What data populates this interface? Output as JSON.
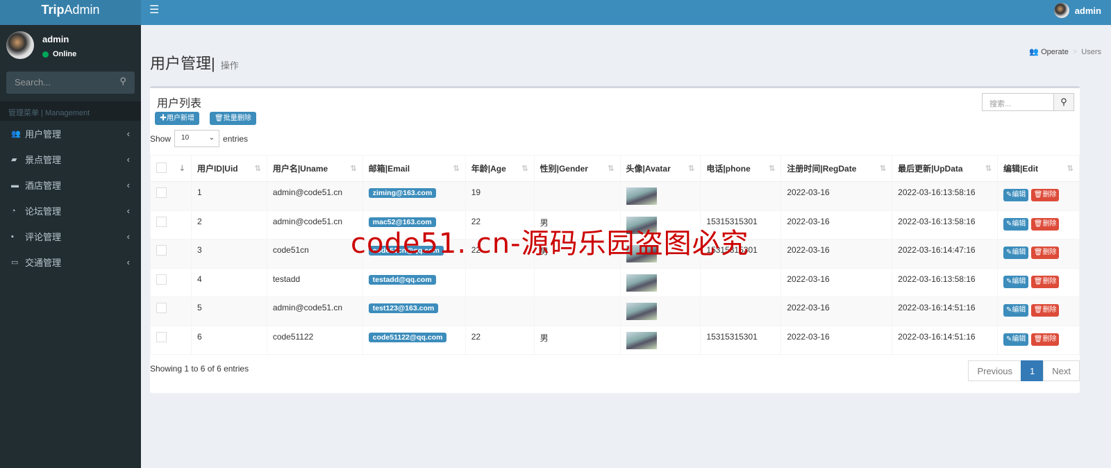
{
  "app": {
    "brand_bold": "Trip",
    "brand_rest": "Admin",
    "top_user": "admin"
  },
  "sidebar": {
    "user": "admin",
    "status": "Online",
    "search_placeholder": "Search...",
    "section": "管理菜单 | Management",
    "items": [
      {
        "label": "用户管理",
        "icon": "users-icon"
      },
      {
        "label": "景点管理",
        "icon": "book-icon"
      },
      {
        "label": "酒店管理",
        "icon": "bed-icon"
      },
      {
        "label": "论坛管理",
        "icon": "rss-icon"
      },
      {
        "label": "评论管理",
        "icon": "comment-icon"
      },
      {
        "label": "交通管理",
        "icon": "car-icon"
      }
    ]
  },
  "page": {
    "title": "用户管理|",
    "subtitle": "操作",
    "breadcrumb": [
      "Operate",
      "Users"
    ]
  },
  "box": {
    "title": "用户列表",
    "add_label": "✚用户新增",
    "batch_delete_label": "🗑批量删除",
    "search_placeholder": "搜索...",
    "show": "Show",
    "entries": "entries",
    "page_size": "10",
    "columns": [
      "用户ID|Uid",
      "用户名|Uname",
      "邮箱|Email",
      "年龄|Age",
      "性别|Gender",
      "头像|Avatar",
      "电话|phone",
      "注册时间|RegDate",
      "最后更新|UpData",
      "编辑|Edit"
    ],
    "rows": [
      {
        "uid": "1",
        "uname": "admin@code51.cn",
        "email": "ziming@163.com",
        "age": "19",
        "gender": "",
        "phone": "",
        "reg": "2022-03-16",
        "upd": "2022-03-16:13:58:16"
      },
      {
        "uid": "2",
        "uname": "admin@code51.cn",
        "email": "mac52@163.com",
        "age": "22",
        "gender": "男",
        "phone": "15315315301",
        "reg": "2022-03-16",
        "upd": "2022-03-16:13:58:16"
      },
      {
        "uid": "3",
        "uname": "code51cn",
        "email": "code51cn@qq.com",
        "age": "22",
        "gender": "男",
        "phone": "15315315301",
        "reg": "2022-03-16",
        "upd": "2022-03-16:14:47:16"
      },
      {
        "uid": "4",
        "uname": "testadd",
        "email": "testadd@qq.com",
        "age": "",
        "gender": "",
        "phone": "",
        "reg": "2022-03-16",
        "upd": "2022-03-16:13:58:16"
      },
      {
        "uid": "5",
        "uname": "admin@code51.cn",
        "email": "test123@163.com",
        "age": "",
        "gender": "",
        "phone": "",
        "reg": "2022-03-16",
        "upd": "2022-03-16:14:51:16"
      },
      {
        "uid": "6",
        "uname": "code51122",
        "email": "code51122@qq.com",
        "age": "22",
        "gender": "男",
        "phone": "15315315301",
        "reg": "2022-03-16",
        "upd": "2022-03-16:14:51:16"
      }
    ],
    "edit_label": "✎编辑",
    "delete_label": "🗑删除",
    "info": "Showing 1 to 6 of 6 entries",
    "prev": "Previous",
    "page": "1",
    "next": "Next"
  },
  "watermark": "code51. cn-源码乐园盗图必究"
}
